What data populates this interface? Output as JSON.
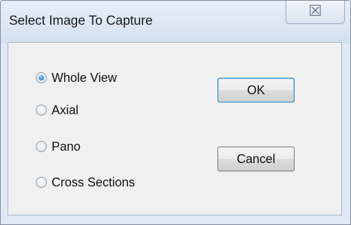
{
  "window": {
    "title": "Select Image To Capture",
    "close_glyph": "☒"
  },
  "options": [
    {
      "label": "Whole View",
      "checked": true
    },
    {
      "label": "Axial",
      "checked": false
    },
    {
      "label": "Pano",
      "checked": false
    },
    {
      "label": "Cross Sections",
      "checked": false
    }
  ],
  "buttons": {
    "ok": "OK",
    "cancel": "Cancel"
  },
  "icons": {
    "close": "close-icon",
    "radio_selected": "radio-selected-icon",
    "radio_empty": "radio-empty-icon"
  }
}
